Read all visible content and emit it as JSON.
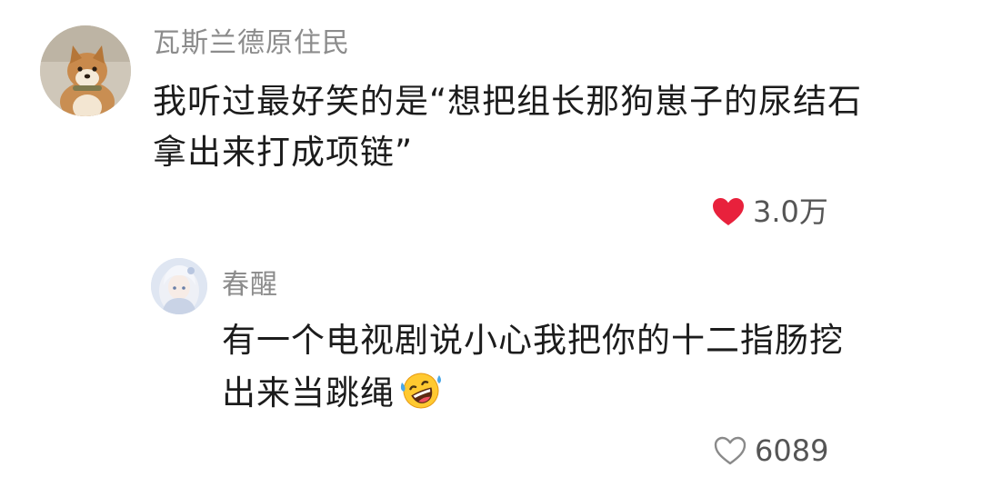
{
  "comment": {
    "username": "瓦斯兰德原住民",
    "text_lines": [
      "我听过最好笑的是“想把组长那狗崽子的尿结石",
      "拿出来打成项链”"
    ],
    "like_count": "3.0万",
    "liked": true,
    "heart_color": "#e8213c",
    "avatar_icon": "shiba-dog-avatar"
  },
  "reply": {
    "username": "春醒",
    "text_lines": [
      "有一个电视剧说小心我把你的十二指肠挖",
      "出来当跳绳"
    ],
    "emoji": "rolling-on-floor-laughing-emoji",
    "like_count": "6089",
    "liked": false,
    "avatar_icon": "anime-girl-avatar"
  },
  "colors": {
    "username": "#8c8c8c",
    "text": "#1c1c1c",
    "count": "#555555",
    "background": "#ffffff"
  }
}
